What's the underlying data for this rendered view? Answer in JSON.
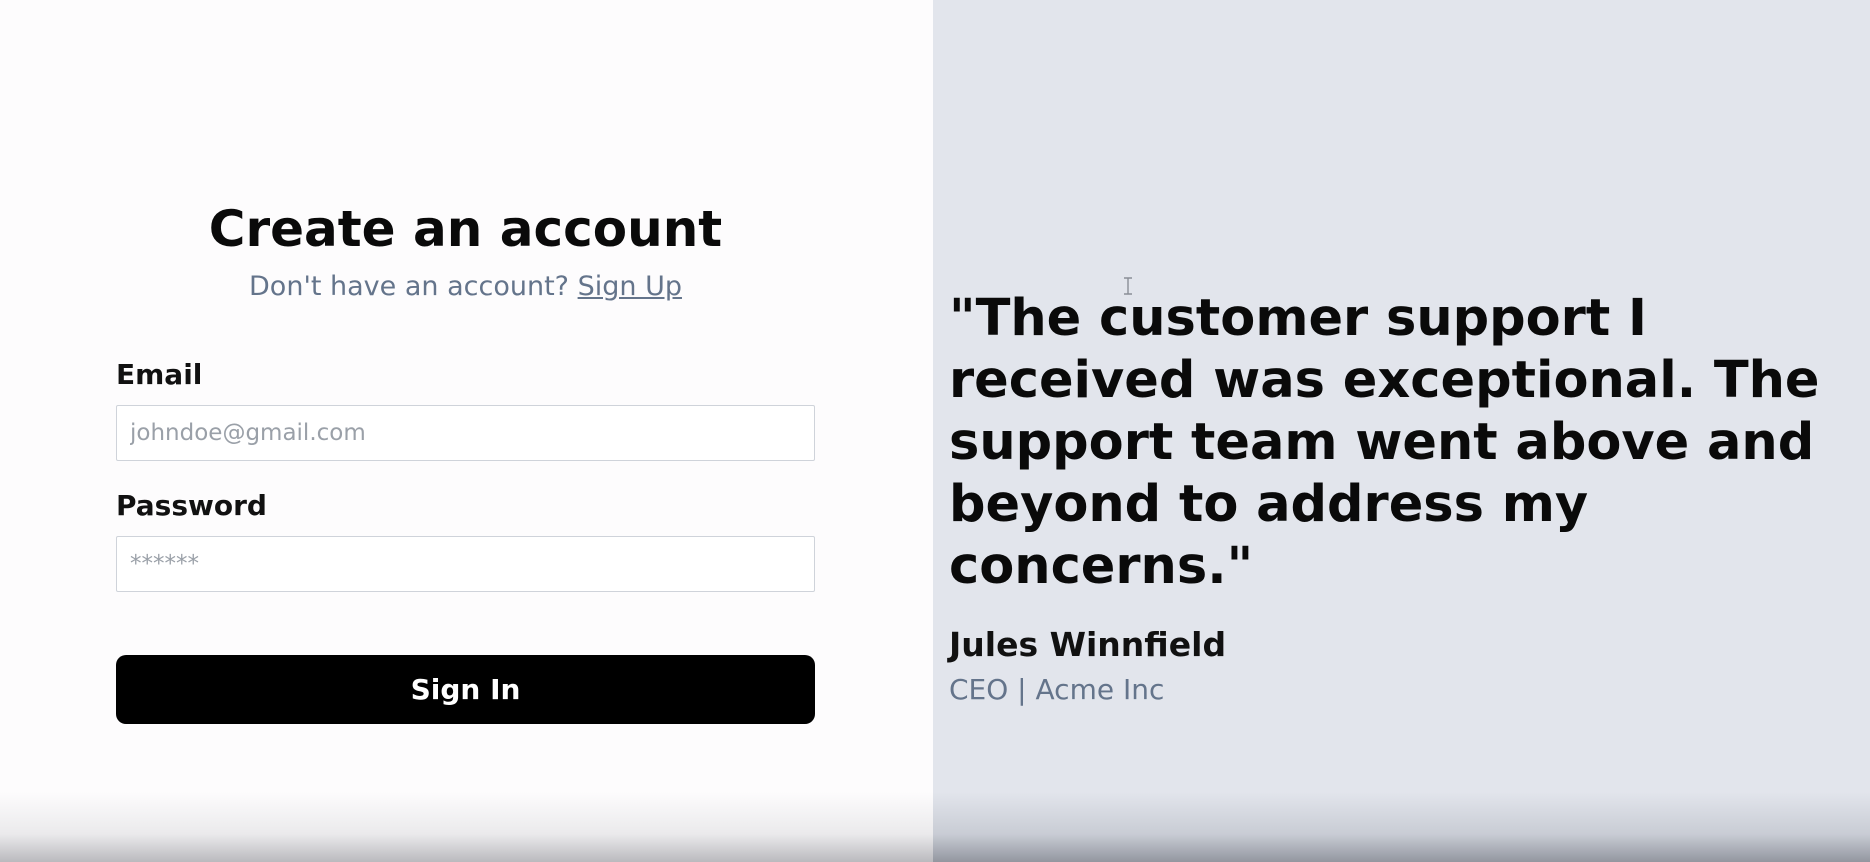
{
  "auth_form": {
    "title": "Create an account",
    "subtitle_prompt": "Don't have an account?",
    "signup_link": "Sign Up",
    "email_label": "Email",
    "email_placeholder": "johndoe@gmail.com",
    "email_value": "",
    "password_label": "Password",
    "password_placeholder": "******",
    "password_value": "",
    "submit_label": "Sign In"
  },
  "testimonial": {
    "quote": "\"The customer support I received was exceptional. The support team went above and beyond to address my concerns.\"",
    "author": "Jules Winnfield",
    "role": "CEO | Acme Inc"
  },
  "colors": {
    "left_background": "#fdfcfd",
    "right_background": "#e2e5ec",
    "muted_text": "#64748b",
    "button_background": "#000000"
  },
  "icons": {
    "cursor": "text-cursor-icon"
  }
}
